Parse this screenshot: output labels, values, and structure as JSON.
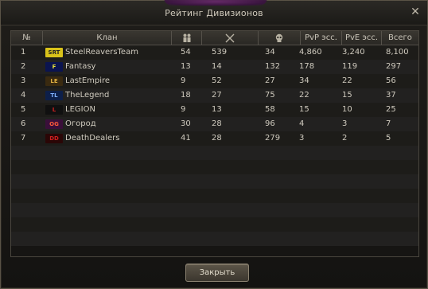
{
  "window": {
    "title": "Рейтинг Дивизионов",
    "close_label": "✕"
  },
  "table": {
    "headers": {
      "num": "№",
      "clan": "Клан",
      "members_icon": "members-icon",
      "kills_icon": "swords-icon",
      "deaths_icon": "skull-icon",
      "pvp": "PvP эсс.",
      "pve": "PvE эсс.",
      "total": "Всего"
    },
    "rows": [
      {
        "num": "1",
        "clan": "SteelReaversTeam",
        "crest": "SRT",
        "crest_bg": "#d9c21a",
        "crest_fg": "#222",
        "members": "54",
        "kills": "539",
        "deaths": "34",
        "pvp": "4,860",
        "pve": "3,240",
        "total": "8,100"
      },
      {
        "num": "2",
        "clan": "Fantasy",
        "crest": "F",
        "crest_bg": "#0b1450",
        "crest_fg": "#e8e23a",
        "members": "13",
        "kills": "14",
        "deaths": "132",
        "pvp": "178",
        "pve": "119",
        "total": "297"
      },
      {
        "num": "3",
        "clan": "LastEmpire",
        "crest": "LE",
        "crest_bg": "#3a2a10",
        "crest_fg": "#e0b040",
        "members": "9",
        "kills": "52",
        "deaths": "27",
        "pvp": "34",
        "pve": "22",
        "total": "56"
      },
      {
        "num": "4",
        "clan": "TheLegend",
        "crest": "TL",
        "crest_bg": "#0d1f4a",
        "crest_fg": "#7fb0ff",
        "members": "18",
        "kills": "27",
        "deaths": "75",
        "pvp": "22",
        "pve": "15",
        "total": "37"
      },
      {
        "num": "5",
        "clan": "LEGION",
        "crest": "L",
        "crest_bg": "#101010",
        "crest_fg": "#cc2020",
        "members": "9",
        "kills": "13",
        "deaths": "58",
        "pvp": "15",
        "pve": "10",
        "total": "25"
      },
      {
        "num": "6",
        "clan": "Огород",
        "crest": "OG",
        "crest_bg": "#3a0f3a",
        "crest_fg": "#ff5a3a",
        "members": "30",
        "kills": "28",
        "deaths": "96",
        "pvp": "4",
        "pve": "3",
        "total": "7"
      },
      {
        "num": "7",
        "clan": "DeathDealers",
        "crest": "DD",
        "crest_bg": "#2a0606",
        "crest_fg": "#d02020",
        "members": "41",
        "kills": "28",
        "deaths": "279",
        "pvp": "3",
        "pve": "2",
        "total": "5"
      }
    ]
  },
  "footer": {
    "close_button": "Закрыть"
  },
  "colors": {
    "header_text": "#c9c4b8",
    "row_text": "#cfcabe",
    "border": "#54504a"
  }
}
